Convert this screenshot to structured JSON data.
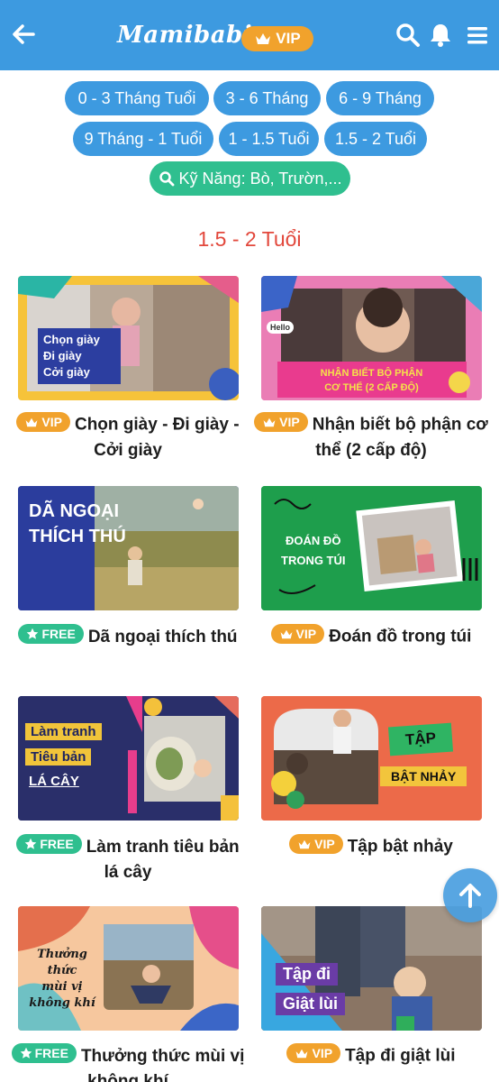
{
  "header": {
    "logo": "Mamibabi",
    "vip_label": "VIP",
    "icons": [
      "back-arrow-icon",
      "search-icon",
      "bell-icon",
      "menu-icon"
    ]
  },
  "filters": {
    "age_chips": [
      "0 - 3 Tháng Tuổi",
      "3 - 6 Tháng",
      "6 - 9 Tháng",
      "9 Tháng - 1 Tuổi",
      "1 - 1.5 Tuổi",
      "1.5 - 2 Tuổi"
    ],
    "skill_chip": "Kỹ Năng: Bò, Trườn,..."
  },
  "section_title": "1.5 - 2 Tuổi",
  "cards": [
    {
      "badge": "VIP",
      "title": "Chọn giày - Đi giày - Cởi giày",
      "thumb_text": "Chọn giày\nĐi giày\nCởi giày"
    },
    {
      "badge": "VIP",
      "title": "Nhận biết bộ phận cơ thể (2 cấp độ)",
      "thumb_text": "NHẬN BIẾT BỘ PHẬN\nCƠ THỂ (2 CẤP ĐỘ)",
      "thumb_hello": "Hello"
    },
    {
      "badge": "FREE",
      "title": "Dã ngoại thích thú",
      "thumb_text": "DÃ NGOẠI\nTHÍCH THÚ"
    },
    {
      "badge": "VIP",
      "title": "Đoán đồ trong túi",
      "thumb_text": "ĐOÁN ĐỒ\nTRONG TÚI"
    },
    {
      "badge": "FREE",
      "title": "Làm tranh tiêu bản lá cây",
      "thumb_text": [
        "Làm tranh",
        "Tiêu bản",
        "LÁ CÂY"
      ]
    },
    {
      "badge": "VIP",
      "title": "Tập bật nhảy",
      "thumb_text": [
        "TẬP",
        "BẬT NHẢY"
      ]
    },
    {
      "badge": "FREE",
      "title": "Thưởng thức mùi vị không khí",
      "thumb_text": "Thưởng thức\nmùi vị\nkhông khí"
    },
    {
      "badge": "VIP",
      "title": "Tập đi giật lùi",
      "thumb_text": [
        "Tập đi",
        "Giật lùi"
      ]
    }
  ],
  "colors": {
    "header": "#3d9ae0",
    "chip": "#3d9ae0",
    "skill_chip": "#2fbf8f",
    "vip": "#f1a22c",
    "free": "#2fbf8f",
    "section_title": "#e2473b"
  }
}
